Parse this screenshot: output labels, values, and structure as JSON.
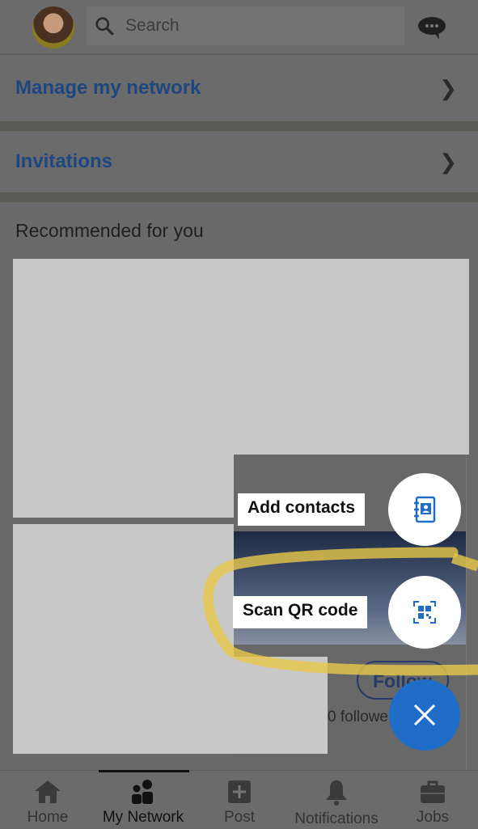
{
  "header": {
    "search_placeholder": "Search",
    "avatar": "profile-photo",
    "messages_icon": "chat-bubble-icon"
  },
  "rows": {
    "manage": "Manage my network",
    "invitations": "Invitations"
  },
  "recommended": {
    "title": "Recommended for you",
    "follow_label": "Follow",
    "followers_text": "0 followe"
  },
  "fab_menu": {
    "add_contacts": "Add contacts",
    "scan_qr": "Scan QR code",
    "close_icon": "close-icon"
  },
  "nav": {
    "items": [
      {
        "label": "Home",
        "icon": "home-icon"
      },
      {
        "label": "My Network",
        "icon": "network-icon",
        "active": true
      },
      {
        "label": "Post",
        "icon": "plus-square-icon"
      },
      {
        "label": "Notifications",
        "icon": "bell-icon"
      },
      {
        "label": "Jobs",
        "icon": "briefcase-icon"
      }
    ]
  },
  "colors": {
    "accent": "#1f6dc7",
    "annotation": "#e8c84a",
    "overlay": "#6b6b6b"
  }
}
